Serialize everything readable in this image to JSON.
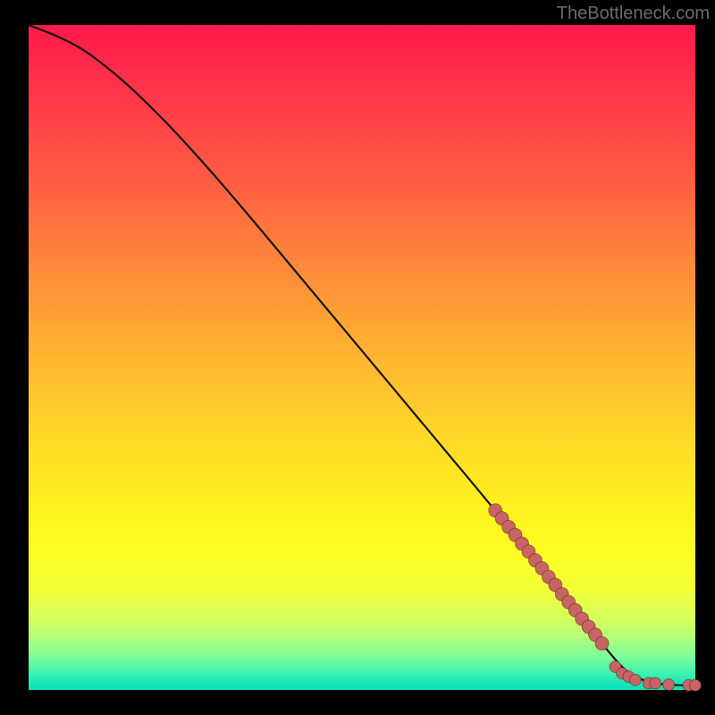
{
  "attribution": "TheBottleneck.com",
  "chart_data": {
    "type": "line",
    "title": "",
    "xlabel": "",
    "ylabel": "",
    "xlim": [
      0,
      100
    ],
    "ylim": [
      0,
      100
    ],
    "curve": {
      "x": [
        0,
        4,
        8,
        12,
        16,
        22,
        30,
        40,
        50,
        60,
        70,
        78,
        84,
        88,
        90,
        92,
        94,
        96,
        98,
        100
      ],
      "y": [
        100,
        98.5,
        96.5,
        93.5,
        90,
        84,
        75,
        63,
        51,
        39,
        27,
        17,
        9.5,
        4.5,
        2.5,
        1.5,
        1.0,
        0.8,
        0.7,
        0.7
      ]
    },
    "markers_on_curve": {
      "x": [
        70,
        71,
        72,
        73,
        74,
        75,
        76,
        77,
        78,
        79,
        80,
        81,
        82,
        83,
        84,
        85,
        86
      ],
      "y": [
        27.0,
        25.8,
        24.5,
        23.3,
        22.0,
        20.8,
        19.5,
        18.3,
        17.0,
        15.8,
        14.4,
        13.2,
        12.0,
        10.7,
        9.5,
        8.3,
        7.0
      ]
    },
    "markers_flat": {
      "x": [
        88,
        89,
        90,
        91,
        93,
        94,
        96,
        99,
        100
      ],
      "y": [
        3.5,
        2.5,
        2.0,
        1.5,
        1.0,
        1.0,
        0.8,
        0.7,
        0.7
      ]
    },
    "marker_color": "#c86464",
    "background": "rainbow_vertical_gradient"
  }
}
